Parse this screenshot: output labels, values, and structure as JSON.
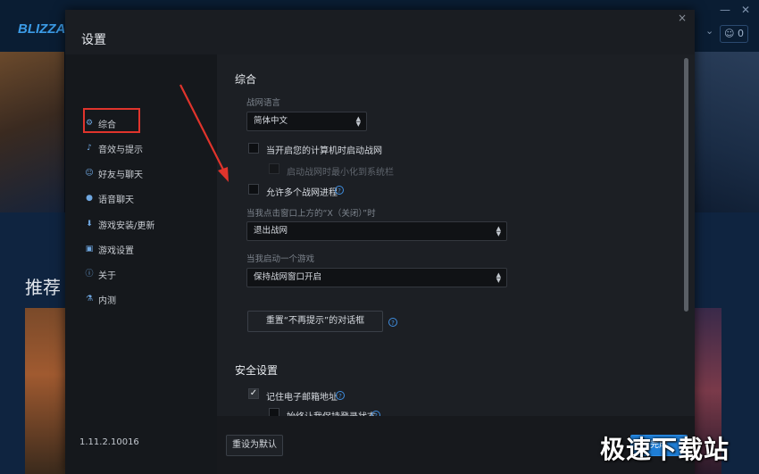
{
  "launcher": {
    "logo": "BLIZZARD",
    "recommended_label": "推荐",
    "friends_count": "0"
  },
  "dialog": {
    "title": "设置",
    "close": "×"
  },
  "sidebar": {
    "items": [
      {
        "label": "综合",
        "icon": "gear-icon"
      },
      {
        "label": "音效与提示",
        "icon": "sound-icon"
      },
      {
        "label": "好友与聊天",
        "icon": "friends-icon"
      },
      {
        "label": "语音聊天",
        "icon": "mic-icon"
      },
      {
        "label": "游戏安装/更新",
        "icon": "download-icon"
      },
      {
        "label": "游戏设置",
        "icon": "game-settings-icon"
      },
      {
        "label": "关于",
        "icon": "info-icon"
      },
      {
        "label": "内测",
        "icon": "flask-icon"
      }
    ],
    "version": "1.11.2.10016"
  },
  "general": {
    "title": "综合",
    "language_label": "战网语言",
    "language_value": "简体中文",
    "launch_on_start": "当开启您的计算机时启动战网",
    "launch_minimized": "启动战网时最小化到系统栏",
    "allow_multiple": "允许多个战网进程",
    "close_label": "当我点击窗口上方的“X（关闭）”时",
    "close_value": "退出战网",
    "game_start_label": "当我启动一个游戏",
    "game_start_value": "保持战网窗口开启",
    "reset_dialogs": "重置“不再提示”的对话框"
  },
  "security": {
    "title": "安全设置",
    "remember_email": "记住电子邮箱地址",
    "stay_logged_in": "始终让我保持登录状态"
  },
  "footer": {
    "reset_default": "重设为默认",
    "done": "完成"
  },
  "watermark": "极速下载站",
  "colors": {
    "highlight_box": "#e0342c",
    "accent_blue": "#1f7ed6",
    "dialog_bg": "#1a1d22"
  }
}
